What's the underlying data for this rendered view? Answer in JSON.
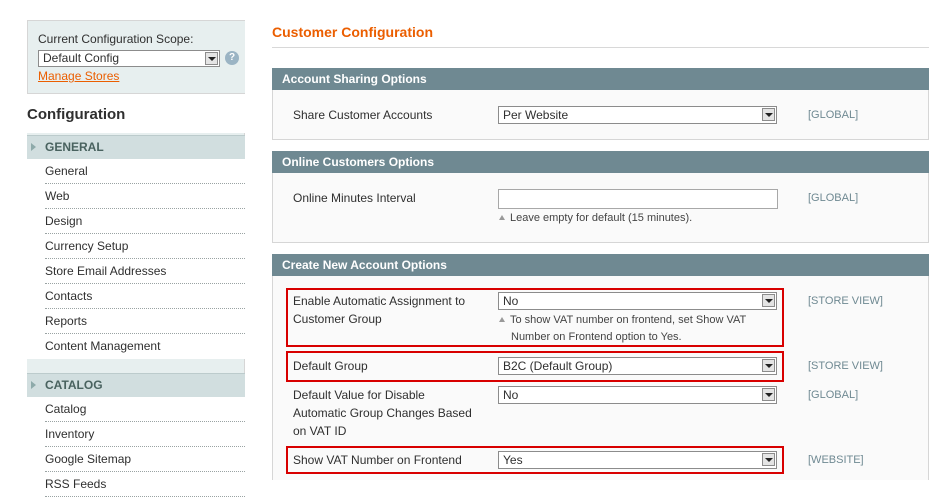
{
  "scope": {
    "label": "Current Configuration Scope:",
    "selected": "Default Config",
    "manage_stores": "Manage Stores"
  },
  "sidebar": {
    "title": "Configuration",
    "groups": [
      {
        "label": "GENERAL",
        "items": [
          "General",
          "Web",
          "Design",
          "Currency Setup",
          "Store Email Addresses",
          "Contacts",
          "Reports",
          "Content Management"
        ]
      },
      {
        "label": "CATALOG",
        "items": [
          "Catalog",
          "Inventory",
          "Google Sitemap",
          "RSS Feeds"
        ]
      }
    ]
  },
  "page": {
    "title": "Customer Configuration"
  },
  "sections": {
    "account_sharing": {
      "title": "Account Sharing Options",
      "share_label": "Share Customer Accounts",
      "share_value": "Per Website",
      "share_scope": "[GLOBAL]"
    },
    "online_customers": {
      "title": "Online Customers Options",
      "interval_label": "Online Minutes Interval",
      "interval_value": "",
      "interval_note": "Leave empty for default (15 minutes).",
      "interval_scope": "[GLOBAL]"
    },
    "create_account": {
      "title": "Create New Account Options",
      "auto_assign_label_1": "Enable Automatic Assignment to",
      "auto_assign_label_2": "Customer Group",
      "auto_assign_value": "No",
      "auto_assign_note_1": "To show VAT number on frontend, set Show VAT",
      "auto_assign_note_2": "Number on Frontend option to Yes.",
      "auto_assign_scope": "[STORE VIEW]",
      "default_group_label": "Default Group",
      "default_group_value": "B2C (Default Group)",
      "default_group_scope": "[STORE VIEW]",
      "disable_auto_label_1": "Default Value for Disable",
      "disable_auto_label_2": "Automatic Group Changes Based",
      "disable_auto_label_3": "on VAT ID",
      "disable_auto_value": "No",
      "disable_auto_scope": "[GLOBAL]",
      "show_vat_label": "Show VAT Number on Frontend",
      "show_vat_value": "Yes",
      "show_vat_scope": "[WEBSITE]"
    }
  },
  "colors": {
    "accent": "#eb5e00",
    "section_header": "#6f8992",
    "highlight": "#d80000"
  }
}
